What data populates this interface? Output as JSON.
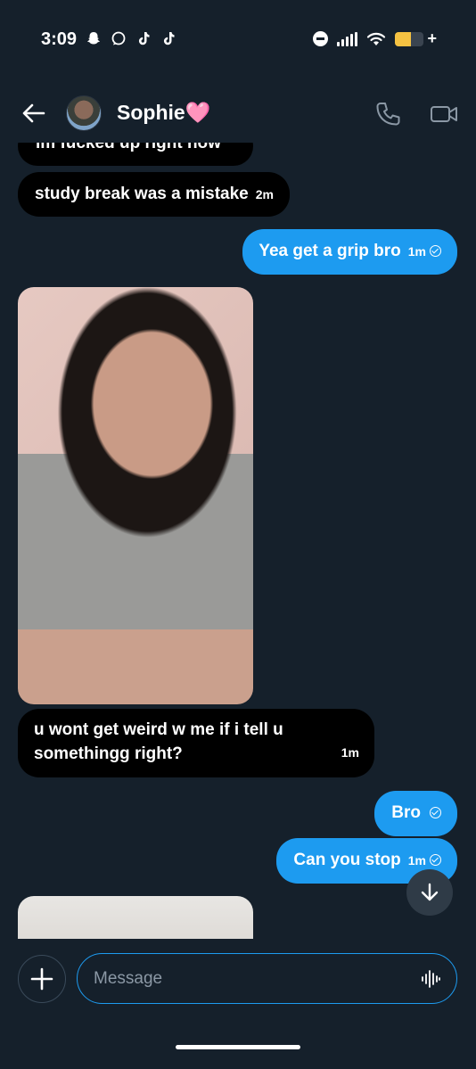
{
  "status_bar": {
    "time": "3:09",
    "left_icons": [
      "snapchat-icon",
      "chat-bubble-icon",
      "tiktok-icon",
      "tiktok-icon"
    ],
    "right_icons": [
      "do-not-disturb-icon",
      "signal-icon",
      "wifi-icon",
      "battery-icon"
    ],
    "battery_level": 0.55,
    "battery_color": "#f5c242"
  },
  "header": {
    "contact_name": "Sophie",
    "contact_emoji": "🩷"
  },
  "messages": [
    {
      "direction": "incoming",
      "text": "im fucked up right now",
      "time": ""
    },
    {
      "direction": "incoming",
      "text": "study break was a mistake",
      "time": "2m"
    },
    {
      "direction": "outgoing",
      "text": "Yea get a grip bro",
      "time": "1m"
    },
    {
      "direction": "incoming",
      "type": "image"
    },
    {
      "direction": "incoming",
      "text_line1": "u wont get weird w me if i tell u",
      "text_line2": "somethingg right?",
      "time": "1m"
    },
    {
      "direction": "outgoing",
      "text": "Bro",
      "time": ""
    },
    {
      "direction": "outgoing",
      "text": "Can you stop",
      "time": "1m"
    },
    {
      "direction": "incoming",
      "type": "image"
    }
  ],
  "composer": {
    "placeholder": "Message"
  },
  "colors": {
    "background": "#15202b",
    "incoming_bubble": "#000000",
    "outgoing_bubble": "#1d9bf0"
  }
}
